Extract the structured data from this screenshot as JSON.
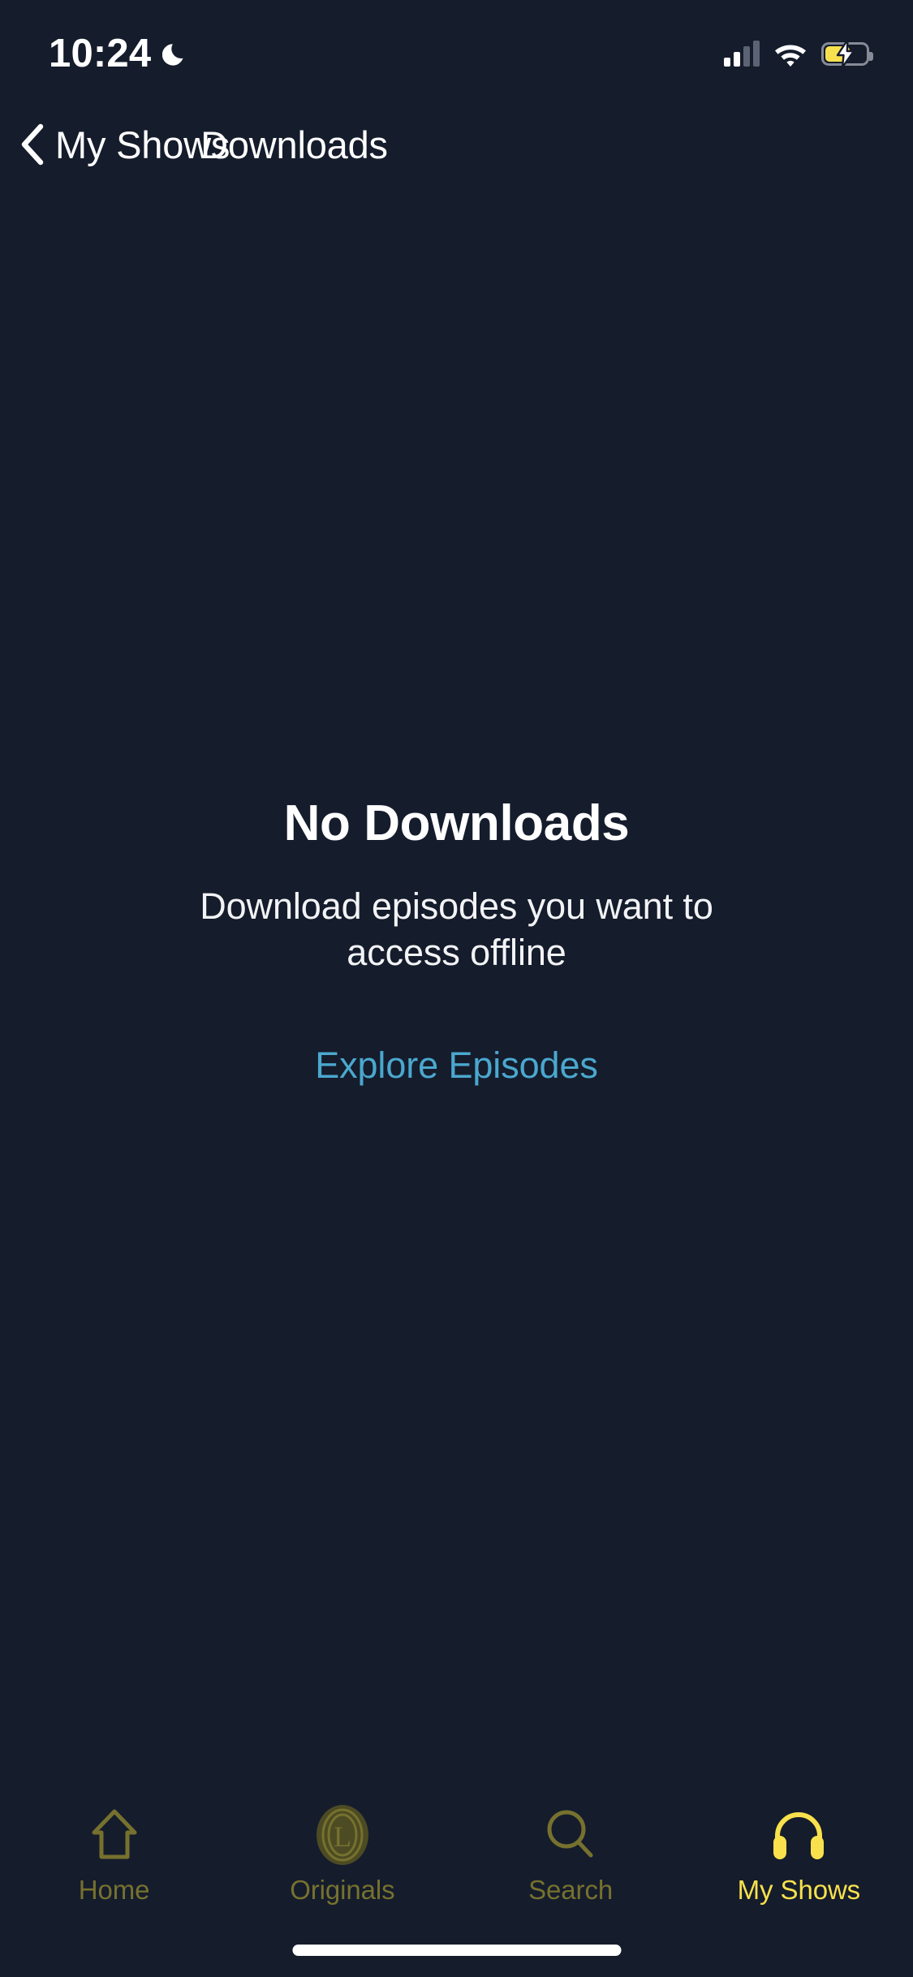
{
  "status_bar": {
    "time": "10:24",
    "dnd_icon": "crescent-moon-icon",
    "signal_icon": "cellular-signal-icon",
    "wifi_icon": "wifi-icon",
    "battery_icon": "battery-charging-icon",
    "battery_accent": "#f7e14f"
  },
  "nav": {
    "back_icon": "chevron-left-icon",
    "back_label": "My Shows",
    "title": "Downloads"
  },
  "empty_state": {
    "title": "No Downloads",
    "subtitle": "Download episodes you want to access offline",
    "action_label": "Explore Episodes",
    "action_color": "#4aa8ce"
  },
  "tab_bar": {
    "active_color": "#f8e14c",
    "inactive_color": "#76712e",
    "items": [
      {
        "label": "Home",
        "icon": "home-icon",
        "active": false
      },
      {
        "label": "Originals",
        "icon": "originals-l-icon",
        "active": false
      },
      {
        "label": "Search",
        "icon": "search-icon",
        "active": false
      },
      {
        "label": "My Shows",
        "icon": "headphones-icon",
        "active": true
      }
    ]
  },
  "home_indicator": {
    "name": "home-indicator"
  },
  "theme": {
    "background": "#151c2c",
    "text_primary": "#ffffff"
  }
}
